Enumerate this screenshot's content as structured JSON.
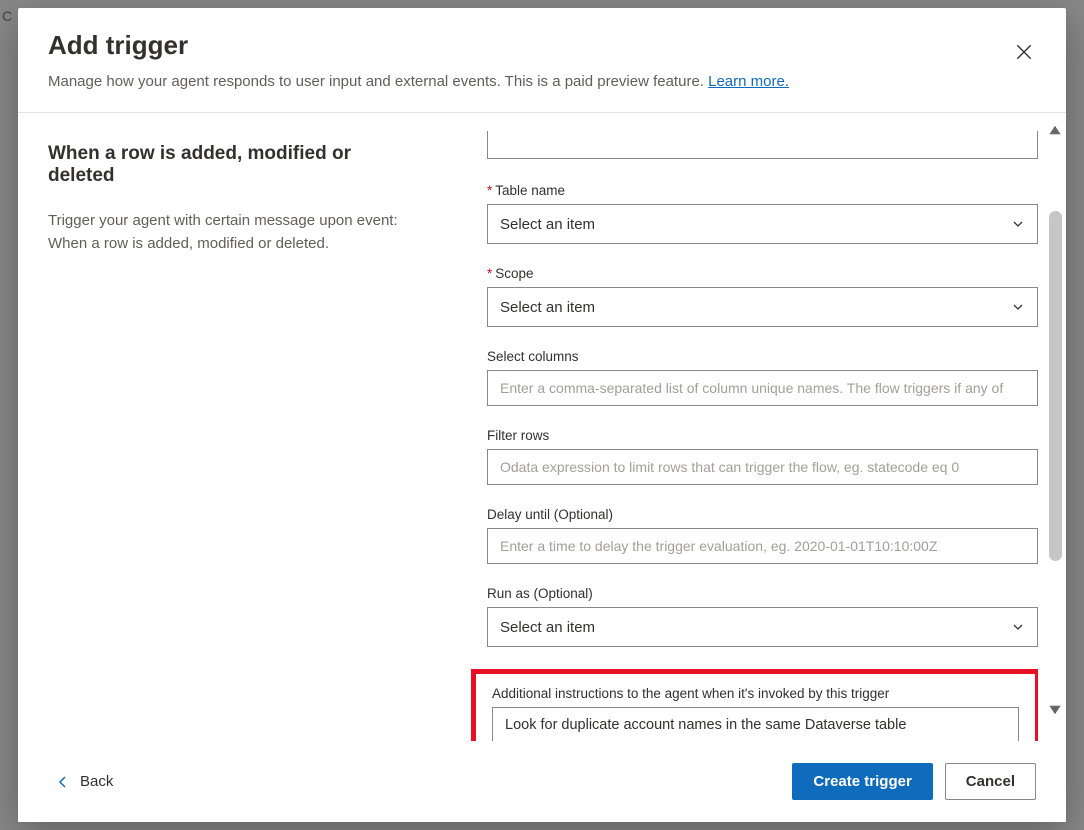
{
  "header": {
    "title": "Add trigger",
    "subtitle": "Manage how your agent responds to user input and external events. This is a paid preview feature. ",
    "learn_more": "Learn more."
  },
  "left": {
    "title": "When a row is added, modified or deleted",
    "description": "Trigger your agent with certain message upon event: When a row is added, modified or deleted."
  },
  "form": {
    "table_name": {
      "label": "Table name",
      "placeholder": "Select an item"
    },
    "scope": {
      "label": "Scope",
      "placeholder": "Select an item"
    },
    "select_columns": {
      "label": "Select columns",
      "placeholder": "Enter a comma-separated list of column unique names. The flow triggers if any of "
    },
    "filter_rows": {
      "label": "Filter rows",
      "placeholder": "Odata expression to limit rows that can trigger the flow, eg. statecode eq 0"
    },
    "delay_until": {
      "label": "Delay until (Optional)",
      "placeholder": "Enter a time to delay the trigger evaluation, eg. 2020-01-01T10:10:00Z"
    },
    "run_as": {
      "label": "Run as (Optional)",
      "placeholder": "Select an item"
    },
    "additional_instructions": {
      "label": "Additional instructions to the agent when it's invoked by this trigger",
      "value": "Look for duplicate account names in the same Dataverse table"
    }
  },
  "footer": {
    "back": "Back",
    "create": "Create trigger",
    "cancel": "Cancel"
  }
}
